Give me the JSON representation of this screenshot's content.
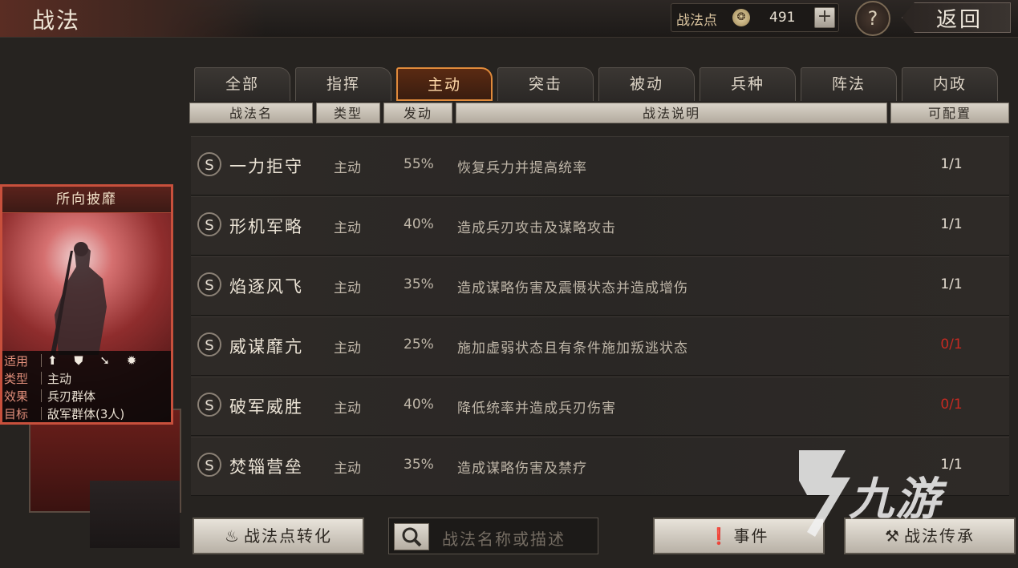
{
  "header": {
    "title": "战法",
    "points_label": "战法点",
    "points_value": "491",
    "help": "?",
    "back": "返回"
  },
  "tabs": [
    "全部",
    "指挥",
    "主动",
    "突击",
    "被动",
    "兵种",
    "阵法",
    "内政"
  ],
  "active_tab": "主动",
  "columns": [
    "战法名",
    "类型",
    "发动",
    "战法说明",
    "可配置"
  ],
  "skills": [
    {
      "badge": "S",
      "name": "一力拒守",
      "type": "主动",
      "rate": "55%",
      "desc": "恢复兵力并提高统率",
      "count": "1/1",
      "count_color": "#e6ded2"
    },
    {
      "badge": "S",
      "name": "形机军略",
      "type": "主动",
      "rate": "40%",
      "desc": "造成兵刃攻击及谋略攻击",
      "count": "1/1",
      "count_color": "#e6ded2"
    },
    {
      "badge": "S",
      "name": "焰逐风飞",
      "type": "主动",
      "rate": "35%",
      "desc": "造成谋略伤害及震慑状态并造成增伤",
      "count": "1/1",
      "count_color": "#e6ded2"
    },
    {
      "badge": "S",
      "name": "威谋靡亢",
      "type": "主动",
      "rate": "25%",
      "desc": "施加虚弱状态且有条件施加叛逃状态",
      "count": "0/1",
      "count_color": "#c42a22"
    },
    {
      "badge": "S",
      "name": "破军威胜",
      "type": "主动",
      "rate": "40%",
      "desc": "降低统率并造成兵刃伤害",
      "count": "0/1",
      "count_color": "#c42a22"
    },
    {
      "badge": "S",
      "name": "焚辎营垒",
      "type": "主动",
      "rate": "35%",
      "desc": "造成谋略伤害及禁疗",
      "count": "1/1",
      "count_color": "#e6ded2"
    }
  ],
  "card": {
    "title": "所向披靡",
    "rows": [
      {
        "k": "适用",
        "v": "⬆ ⛊ ➘ ✹"
      },
      {
        "k": "类型",
        "v": "主动"
      },
      {
        "k": "效果",
        "v": "兵刃群体"
      },
      {
        "k": "目标",
        "v": "敌军群体(3人)"
      }
    ]
  },
  "buttons": {
    "convert": "战法点转化",
    "search_placeholder": "战法名称或描述",
    "events": "事件",
    "inherit": "战法传承"
  },
  "watermark": "九游",
  "icons": {
    "points": "coin-icon",
    "plus": "plus-icon",
    "search": "magnifier-icon",
    "events": "exclamation-icon",
    "inherit": "hammer-icon",
    "convert": "flame-icon"
  }
}
